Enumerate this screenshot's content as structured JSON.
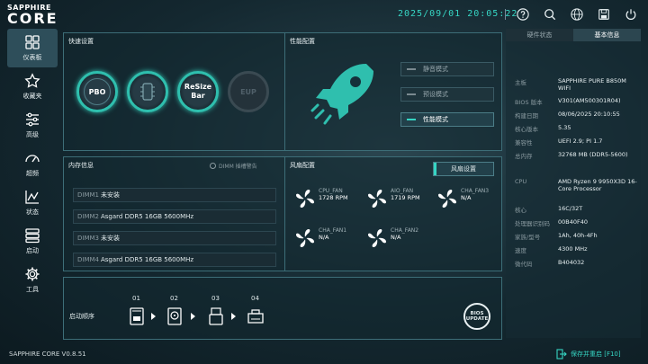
{
  "brand": {
    "line1": "SAPPHIRE",
    "line2": "CORE"
  },
  "datetime": "2025/09/01 20:05:22",
  "topbar": {
    "icons": [
      "help-icon",
      "search-icon",
      "language-icon",
      "save-icon",
      "power-icon"
    ]
  },
  "sidebar": {
    "items": [
      {
        "label": "仪表板",
        "icon": "dashboard-icon",
        "active": true
      },
      {
        "label": "收藏夹",
        "icon": "star-icon"
      },
      {
        "label": "高级",
        "icon": "sliders-icon"
      },
      {
        "label": "超频",
        "icon": "gauge-icon"
      },
      {
        "label": "状态",
        "icon": "chart-icon"
      },
      {
        "label": "启动",
        "icon": "boot-icon"
      },
      {
        "label": "工具",
        "icon": "gear-icon"
      }
    ]
  },
  "quick": {
    "title": "快速设置",
    "buttons": [
      {
        "label": "PBO",
        "state": "on"
      },
      {
        "label": "",
        "state": "on"
      },
      {
        "label": "ReSize Bar",
        "state": "on"
      },
      {
        "label": "EUP",
        "state": "off"
      }
    ]
  },
  "perf": {
    "title": "性能配置",
    "modes": [
      {
        "label": "静音模式",
        "active": false
      },
      {
        "label": "预设模式",
        "active": false
      },
      {
        "label": "性能模式",
        "active": true
      }
    ]
  },
  "memory": {
    "title": "内存信息",
    "warning_label": "DIMM 插槽警告",
    "slots": [
      {
        "slot": "DIMM1",
        "value": "未安装"
      },
      {
        "slot": "DIMM2",
        "value": "Asgard DDR5 16GB 5600MHz"
      },
      {
        "slot": "DIMM3",
        "value": "未安装"
      },
      {
        "slot": "DIMM4",
        "value": "Asgard DDR5 16GB 5600MHz"
      }
    ]
  },
  "fans": {
    "title": "风扇配置",
    "settings_label": "风扇设置",
    "items": [
      {
        "name": "CPU_FAN",
        "value": "1728 RPM"
      },
      {
        "name": "AIO_FAN",
        "value": "1719 RPM"
      },
      {
        "name": "CHA_FAN3",
        "value": "N/A"
      },
      {
        "name": "CHA_FAN1",
        "value": "N/A"
      },
      {
        "name": "CHA_FAN2",
        "value": "N/A"
      }
    ]
  },
  "boot": {
    "title": "启动顺序",
    "order": [
      "01",
      "02",
      "03",
      "04"
    ],
    "devices": [
      "nvme-icon",
      "hdd-icon",
      "usb-icon",
      "network-icon"
    ],
    "bios_update_label1": "BIOS",
    "bios_update_label2": "UPDATE"
  },
  "rightpanel": {
    "tabs": [
      {
        "label": "硬件状态",
        "active": false
      },
      {
        "label": "基本信息",
        "active": true
      }
    ],
    "info": [
      {
        "k": "主板",
        "v": "SAPPHIRE PURE B850M WIFI"
      },
      {
        "k": "BIOS 版本",
        "v": "V301(AM500301R04)"
      },
      {
        "k": "构建日期",
        "v": "08/06/2025 20:10:55"
      },
      {
        "k": "核心版本",
        "v": "5.35"
      },
      {
        "k": "兼容性",
        "v": "UEFI 2.9; PI 1.7"
      },
      {
        "k": "总内存",
        "v": "32768 MB (DDR5-5600)"
      },
      {
        "k": "CPU",
        "v": "AMD Ryzen 9 9950X3D 16-Core Processor"
      },
      {
        "k": "核心",
        "v": "16C/32T"
      },
      {
        "k": "处理器识别码",
        "v": "00B40F40"
      },
      {
        "k": "家族/型号",
        "v": "1Ah, 40h-4Fh"
      },
      {
        "k": "速度",
        "v": "4300 MHz"
      },
      {
        "k": "微代码",
        "v": "B404032"
      }
    ]
  },
  "footer": {
    "version": "SAPPHIRE CORE V0.8.51",
    "exit_label": "保存并重启 [F10]"
  },
  "colors": {
    "accent": "#36d6c4",
    "panel_border": "#3d6e78"
  }
}
